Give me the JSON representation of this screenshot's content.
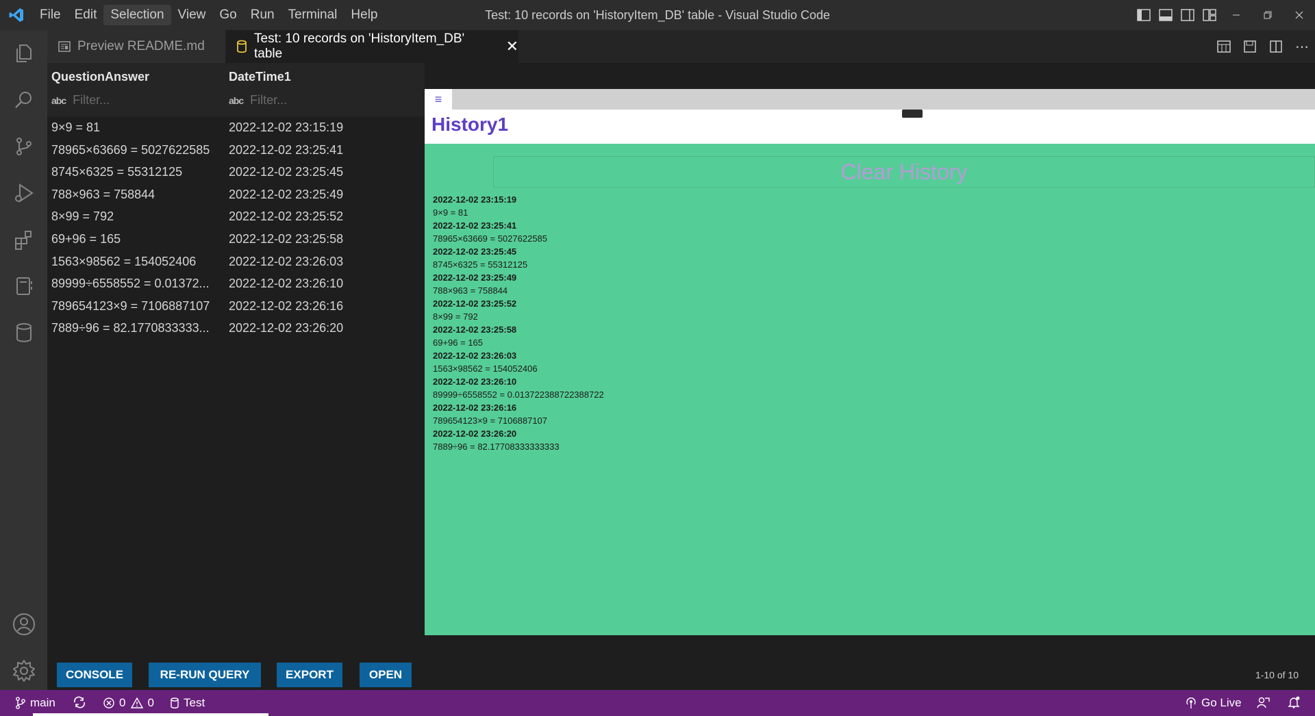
{
  "window": {
    "title": "Test: 10 records on 'HistoryItem_DB' table - Visual Studio Code"
  },
  "menu": [
    "File",
    "Edit",
    "Selection",
    "View",
    "Go",
    "Run",
    "Terminal",
    "Help"
  ],
  "tabs": [
    {
      "label": "Preview README.md",
      "active": false
    },
    {
      "label": "Test: 10 records on 'HistoryItem_DB' table",
      "active": true
    }
  ],
  "grid": {
    "columns": [
      "QuestionAnswer",
      "DateTime1"
    ],
    "filter_placeholder": "Filter...",
    "filter_badge": "abc",
    "rows": [
      [
        "9×9 = 81",
        "2022-12-02 23:15:19"
      ],
      [
        "78965×63669 = 5027622585",
        "2022-12-02 23:25:41"
      ],
      [
        "8745×6325 = 55312125",
        "2022-12-02 23:25:45"
      ],
      [
        "788×963 = 758844",
        "2022-12-02 23:25:49"
      ],
      [
        "8×99 = 792",
        "2022-12-02 23:25:52"
      ],
      [
        "69+96 = 165",
        "2022-12-02 23:25:58"
      ],
      [
        "1563×98562 = 154052406",
        "2022-12-02 23:26:03"
      ],
      [
        "89999÷6558552 = 0.01372...",
        "2022-12-02 23:26:10"
      ],
      [
        "789654123×9 = 7106887107",
        "2022-12-02 23:26:16"
      ],
      [
        "7889÷96 = 82.1770833333...",
        "2022-12-02 23:26:20"
      ]
    ]
  },
  "preview": {
    "title": "History1",
    "clear_button": "Clear History",
    "entries": [
      {
        "date": "2022-12-02 23:15:19",
        "expr": "9×9 = 81"
      },
      {
        "date": "2022-12-02 23:25:41",
        "expr": "78965×63669 = 5027622585"
      },
      {
        "date": "2022-12-02 23:25:45",
        "expr": "8745×6325 = 55312125"
      },
      {
        "date": "2022-12-02 23:25:49",
        "expr": "788×963 = 758844"
      },
      {
        "date": "2022-12-02 23:25:52",
        "expr": "8×99 = 792"
      },
      {
        "date": "2022-12-02 23:25:58",
        "expr": "69+96 = 165"
      },
      {
        "date": "2022-12-02 23:26:03",
        "expr": "1563×98562 = 154052406"
      },
      {
        "date": "2022-12-02 23:26:10",
        "expr": "89999÷6558552 = 0.013722388722388722"
      },
      {
        "date": "2022-12-02 23:26:16",
        "expr": "789654123×9 = 7106887107"
      },
      {
        "date": "2022-12-02 23:26:20",
        "expr": "7889÷96 = 82.17708333333333"
      }
    ]
  },
  "actions": {
    "console": "CONSOLE",
    "rerun": "RE-RUN QUERY",
    "export": "EXPORT",
    "open": "OPEN",
    "page_count": "1-10 of 10"
  },
  "status": {
    "branch": "main",
    "errors": "0",
    "warnings": "0",
    "db": "Test",
    "go_live": "Go Live"
  },
  "colors": {
    "status_bar": "#68217a",
    "preview_bg": "#55cd96",
    "button_bg": "#0e639c",
    "preview_title": "#5b3fc4"
  }
}
